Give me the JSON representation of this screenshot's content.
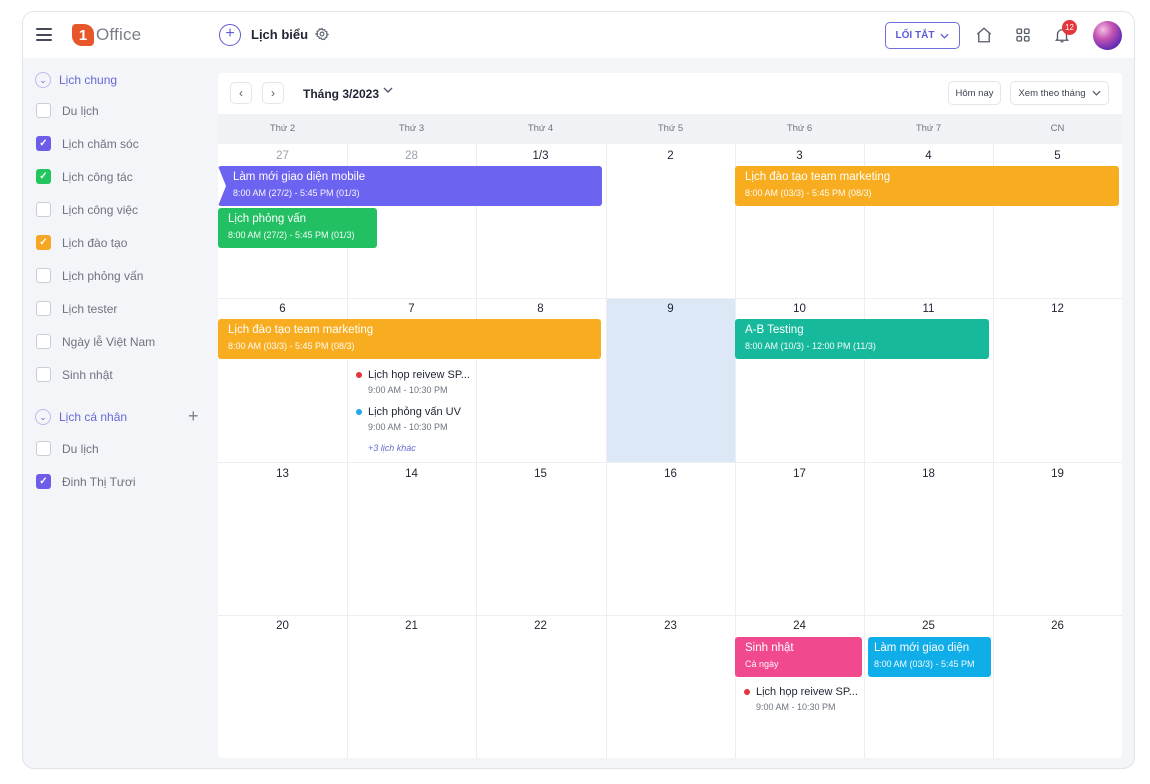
{
  "header": {
    "logo_mark": "1",
    "logo_text": "Office",
    "title": "Lịch biểu",
    "shortcut_label": "LỐI TẮT",
    "notification_count": "12"
  },
  "sidebar": {
    "group1": "Lịch chung",
    "group1_items": [
      {
        "label": "Du lịch",
        "checked": false,
        "color": ""
      },
      {
        "label": "Lịch chăm sóc",
        "checked": true,
        "color": "#6c5ce7"
      },
      {
        "label": "Lịch công tác",
        "checked": true,
        "color": "#22c55e"
      },
      {
        "label": "Lịch công việc",
        "checked": false,
        "color": ""
      },
      {
        "label": "Lịch đào tạo",
        "checked": true,
        "color": "#f5a623"
      },
      {
        "label": "Lịch phỏng vấn",
        "checked": false,
        "color": ""
      },
      {
        "label": "Lịch tester",
        "checked": false,
        "color": ""
      },
      {
        "label": "Ngày lễ Việt Nam",
        "checked": false,
        "color": ""
      },
      {
        "label": "Sinh nhật",
        "checked": false,
        "color": ""
      }
    ],
    "group2": "Lịch cá nhân",
    "group2_items": [
      {
        "label": "Du lịch",
        "checked": false,
        "color": ""
      },
      {
        "label": "Đinh Thị Tươi",
        "checked": true,
        "color": "#6c5ce7"
      }
    ]
  },
  "calendar": {
    "month_label": "Tháng 3/2023",
    "today_label": "Hôm nay",
    "view_label": "Xem theo tháng",
    "weekdays": [
      "Thứ 2",
      "Thứ 3",
      "Thứ 4",
      "Thứ 5",
      "Thứ 6",
      "Thứ 7",
      "CN"
    ],
    "weeks": [
      [
        "27",
        "28",
        "1/3",
        "2",
        "3",
        "4",
        "5"
      ],
      [
        "6",
        "7",
        "8",
        "9",
        "10",
        "11",
        "12"
      ],
      [
        "13",
        "14",
        "15",
        "16",
        "17",
        "18",
        "19"
      ],
      [
        "20",
        "21",
        "22",
        "23",
        "24",
        "25",
        "26"
      ]
    ],
    "events": {
      "e1": {
        "title": "Làm mới giao diện mobile",
        "time": "8:00 AM (27/2) - 5:45 PM (01/3)",
        "color": "#6c63f0"
      },
      "e2": {
        "title": "Lịch đào tạo team marketing",
        "time": "8:00 AM (03/3) - 5:45 PM (08/3)",
        "color": "#f7ad1f"
      },
      "e3": {
        "title": "Lịch phỏng vấn",
        "time": "8:00 AM (27/2) - 5:45 PM (01/3)",
        "color": "#22c063"
      },
      "e4": {
        "title": "Lịch đào tạo team marketing",
        "time": "8:00 AM (03/3) - 5:45 PM (08/3)",
        "color": "#f7ad1f"
      },
      "e5": {
        "title": "A-B Testing",
        "time": "8:00 AM (10/3) - 12:00 PM (11/3)",
        "color": "#17b99c"
      },
      "e6": {
        "title": "Sinh nhật",
        "time": "Cả ngày",
        "color": "#f0498d"
      },
      "e7": {
        "title": "Làm mới giao diện",
        "time": "8:00 AM (03/3) - 5:45 PM",
        "color": "#10aee8"
      }
    },
    "dot_events": {
      "d1": {
        "title": "Lịch họp reivew SP...",
        "time": "9:00 AM - 10:30 PM",
        "color": "#e5343a"
      },
      "d2": {
        "title": "Lịch phỏng vấn UV",
        "time": "9:00 AM - 10:30 PM",
        "color": "#1ea7f0"
      },
      "d3": {
        "title": "Lịch họp reivew SP...",
        "time": "9:00 AM - 10:30 PM",
        "color": "#e5343a"
      }
    },
    "more_label": "+3 lịch khác"
  }
}
